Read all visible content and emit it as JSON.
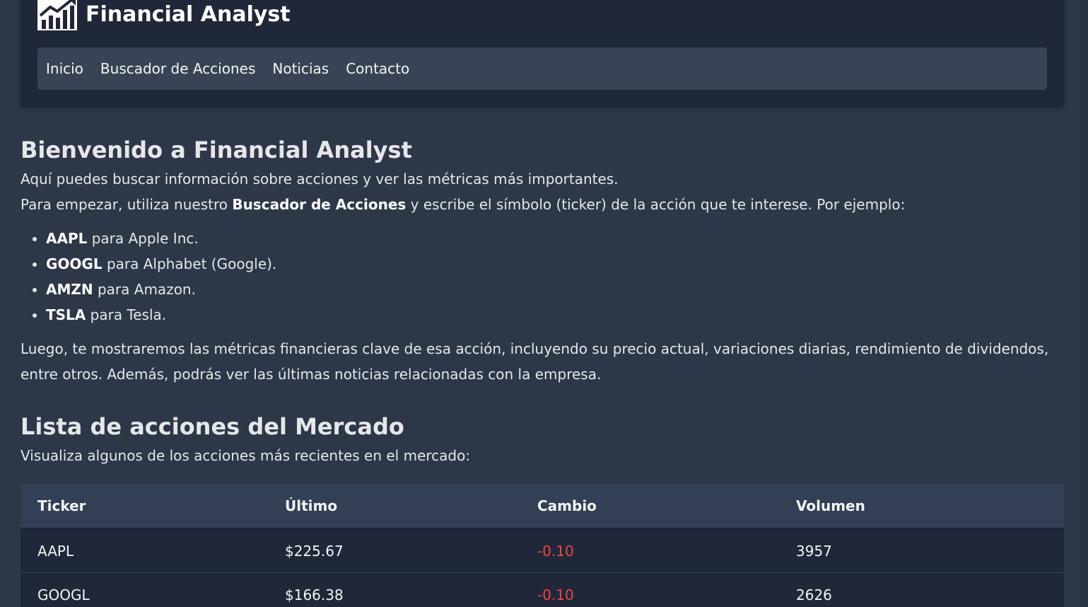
{
  "header": {
    "brand_title": "Financial Analyst",
    "logo_icon": "chart-growth-icon"
  },
  "nav": {
    "items": [
      {
        "label": "Inicio"
      },
      {
        "label": "Buscador de Acciones"
      },
      {
        "label": "Noticias"
      },
      {
        "label": "Contacto"
      }
    ]
  },
  "welcome": {
    "title": "Bienvenido a Financial Analyst",
    "line1": "Aquí puedes buscar información sobre acciones y ver las métricas más importantes.",
    "line2_before": "Para empezar, utiliza nuestro ",
    "line2_bold": "Buscador de Acciones",
    "line2_after": " y escribe el símbolo (ticker) de la acción que te interese. Por ejemplo:",
    "examples": [
      {
        "ticker": "AAPL",
        "desc": " para Apple Inc."
      },
      {
        "ticker": "GOOGL",
        "desc": " para Alphabet (Google)."
      },
      {
        "ticker": "AMZN",
        "desc": " para Amazon."
      },
      {
        "ticker": "TSLA",
        "desc": " para Tesla."
      }
    ],
    "outro": "Luego, te mostraremos las métricas financieras clave de esa acción, incluyendo su precio actual, variaciones diarias, rendimiento de dividendos, entre otros. Además, podrás ver las últimas noticias relacionadas con la empresa."
  },
  "market": {
    "title": "Lista de acciones del Mercado",
    "subtitle": "Visualiza algunos de los acciones más recientes en el mercado:",
    "columns": [
      "Ticker",
      "Último",
      "Cambio",
      "Volumen"
    ],
    "rows": [
      {
        "ticker": "AAPL",
        "last": "$225.67",
        "change": "-0.10",
        "volume": "3957"
      },
      {
        "ticker": "GOOGL",
        "last": "$166.38",
        "change": "-0.10",
        "volume": "2626"
      }
    ]
  },
  "colors": {
    "background": "#2e3748",
    "header_bg": "#1f2738",
    "nav_bg": "#3a4356",
    "negative": "#ef4444"
  }
}
